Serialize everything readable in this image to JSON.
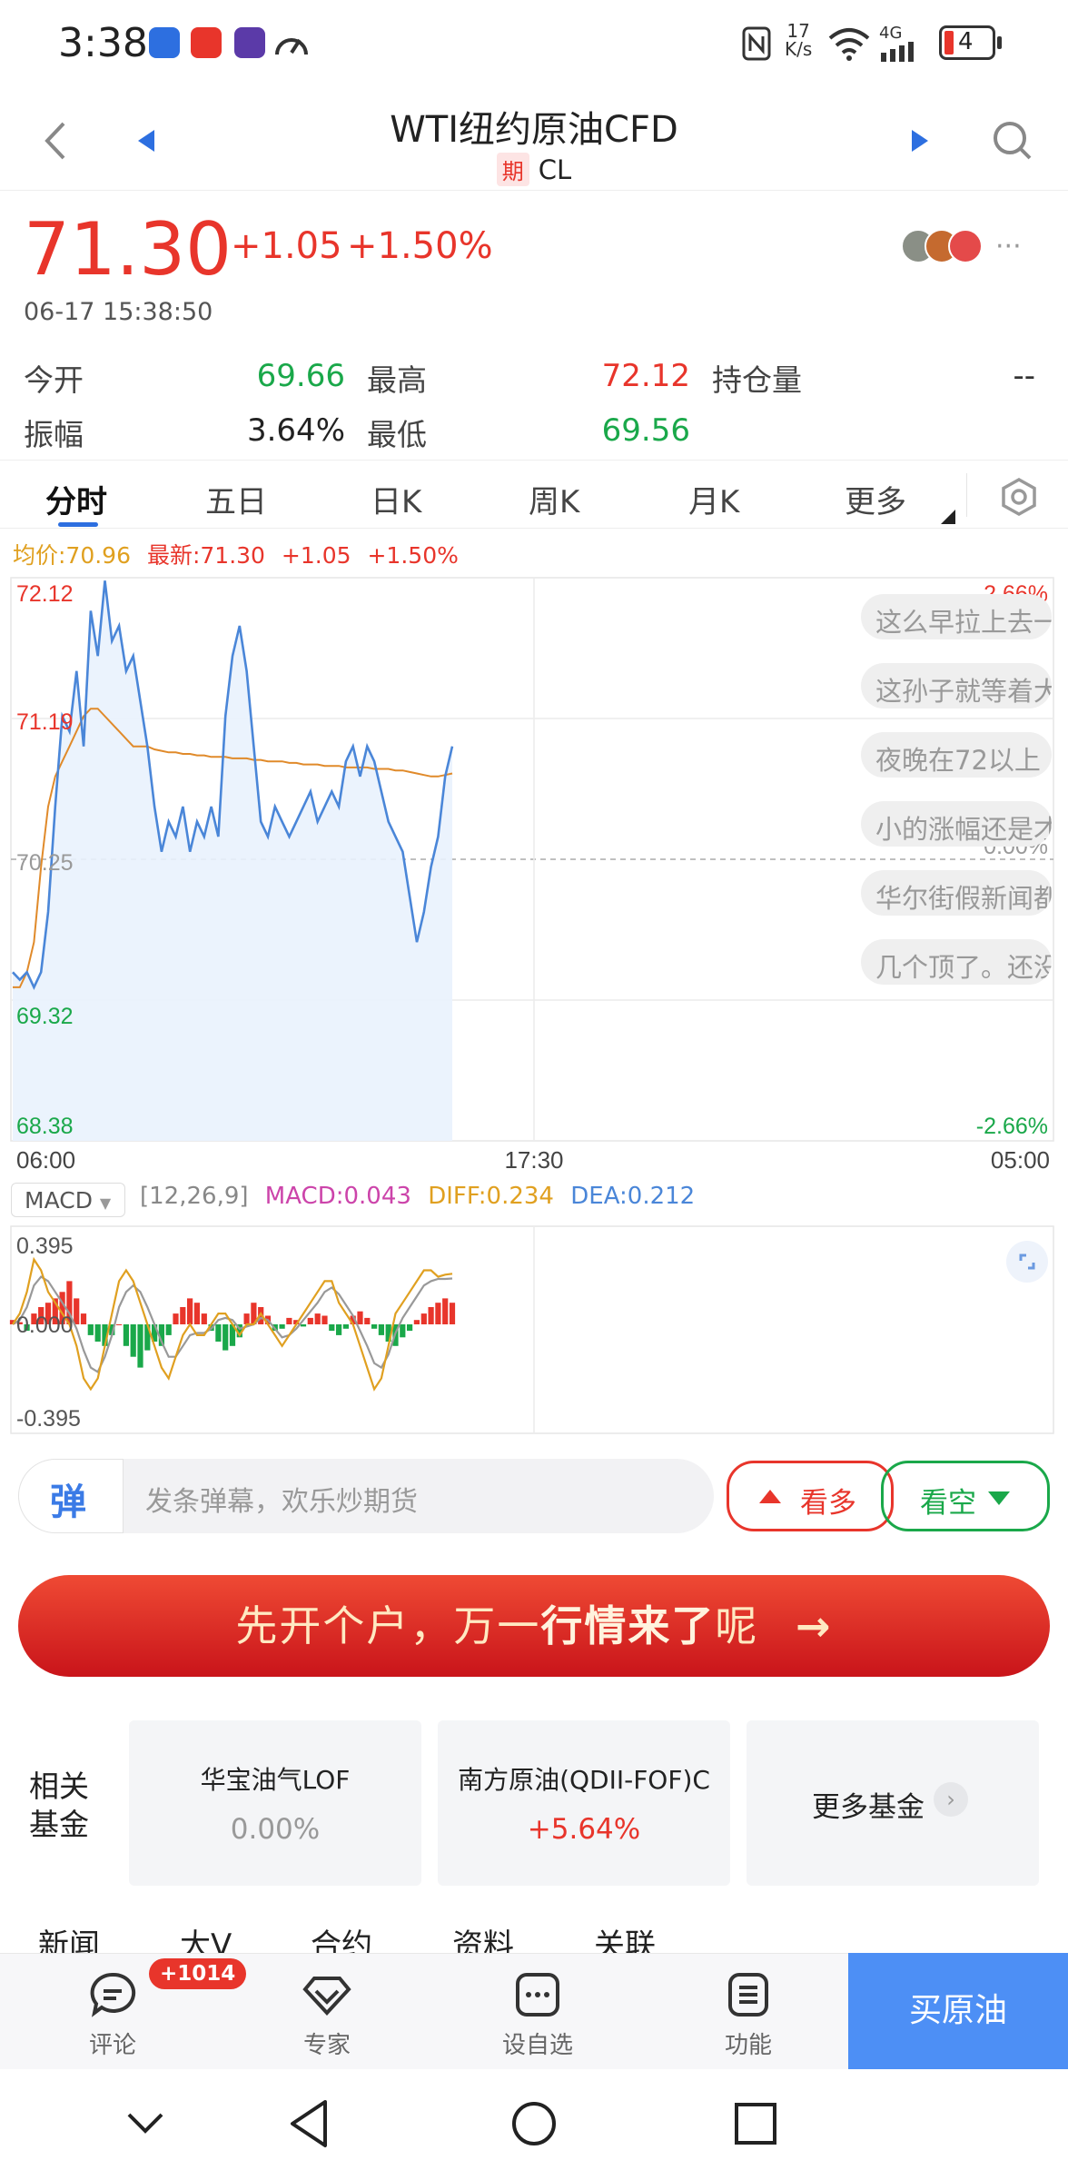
{
  "status_bar": {
    "time": "3:38",
    "net_speed_value": "17",
    "net_speed_unit": "K/s",
    "network": "4G",
    "battery": "4"
  },
  "nav": {
    "title": "WTI纽约原油CFD",
    "tag": "期",
    "code": "CL"
  },
  "quote": {
    "price": "71.30",
    "change": "+1.05",
    "change_pct": "+1.50%",
    "time": "06-17 15:38:50",
    "more": "···",
    "fields": [
      {
        "label": "今开",
        "value": "69.66",
        "color": "green"
      },
      {
        "label": "最高",
        "value": "72.12",
        "color": "red"
      },
      {
        "label": "持仓量",
        "value": "--",
        "color": "dark"
      },
      {
        "label": "振幅",
        "value": "3.64%",
        "color": "dark"
      },
      {
        "label": "最低",
        "value": "69.56",
        "color": "green"
      }
    ]
  },
  "tabs": [
    "分时",
    "五日",
    "日K",
    "周K",
    "月K",
    "更多"
  ],
  "chart_legend": {
    "avg": "均价:70.96",
    "latest": "最新:71.30",
    "change": "+1.05",
    "change_pct": "+1.50%"
  },
  "chart_data": {
    "type": "line",
    "title": "",
    "y_ticks_left": [
      "72.12",
      "71.19",
      "70.25",
      "69.32",
      "68.38"
    ],
    "y_ticks_right": [
      "2.66%",
      "0.00%",
      "-2.66%"
    ],
    "x_ticks": [
      "06:00",
      "17:30",
      "05:00"
    ],
    "ylim": [
      68.38,
      72.12
    ],
    "series": [
      {
        "name": "最新",
        "color": "#4a86d8",
        "values": [
          69.5,
          69.45,
          69.5,
          69.4,
          69.5,
          69.9,
          70.6,
          71.2,
          71.1,
          71.5,
          71.0,
          71.9,
          71.6,
          72.1,
          71.7,
          71.8,
          71.5,
          71.6,
          71.3,
          71.0,
          70.6,
          70.3,
          70.5,
          70.4,
          70.6,
          70.3,
          70.5,
          70.4,
          70.6,
          70.4,
          71.2,
          71.6,
          71.8,
          71.5,
          71.0,
          70.5,
          70.4,
          70.6,
          70.5,
          70.4,
          70.5,
          70.6,
          70.7,
          70.5,
          70.6,
          70.7,
          70.6,
          70.9,
          71.0,
          70.8,
          71.0,
          70.9,
          70.7,
          70.5,
          70.4,
          70.3,
          70.0,
          69.7,
          69.9,
          70.2,
          70.4,
          70.8,
          71.0
        ]
      },
      {
        "name": "均价",
        "color": "#e08a2a",
        "values": [
          69.4,
          69.4,
          69.5,
          69.7,
          70.2,
          70.6,
          70.8,
          70.9,
          71.0,
          71.1,
          71.2,
          71.25,
          71.25,
          71.2,
          71.15,
          71.1,
          71.05,
          71.0,
          71.0,
          71.0,
          70.98,
          70.97,
          70.96,
          70.96,
          70.95,
          70.95,
          70.94,
          70.94,
          70.93,
          70.93,
          70.93,
          70.92,
          70.92,
          70.92,
          70.91,
          70.91,
          70.9,
          70.9,
          70.9,
          70.89,
          70.89,
          70.88,
          70.88,
          70.88,
          70.87,
          70.87,
          70.87,
          70.86,
          70.86,
          70.86,
          70.86,
          70.85,
          70.85,
          70.85,
          70.84,
          70.84,
          70.83,
          70.82,
          70.81,
          70.8,
          70.8,
          70.81,
          70.82
        ]
      }
    ],
    "macd": {
      "selector": "MACD",
      "params": "[12,26,9]",
      "macd": "MACD:0.043",
      "diff": "DIFF:0.234",
      "dea": "DEA:0.212",
      "y_ticks": [
        "0.395",
        "0.000",
        "-0.395"
      ],
      "ylim": [
        -0.395,
        0.395
      ],
      "hist": [
        0.02,
        0.01,
        -0.03,
        0.05,
        0.08,
        0.1,
        0.12,
        0.15,
        0.2,
        0.12,
        0.05,
        -0.05,
        -0.08,
        -0.1,
        -0.05,
        0.0,
        -0.1,
        -0.15,
        -0.2,
        -0.12,
        -0.08,
        -0.1,
        -0.05,
        0.05,
        0.08,
        0.12,
        0.1,
        0.05,
        -0.03,
        -0.08,
        -0.12,
        -0.1,
        -0.06,
        0.05,
        0.1,
        0.08,
        0.04,
        -0.03,
        -0.02,
        0.03,
        0.02,
        -0.01,
        0.03,
        0.05,
        0.04,
        -0.03,
        -0.05,
        -0.02,
        0.04,
        0.06,
        0.03,
        -0.02,
        -0.05,
        -0.08,
        -0.1,
        -0.06,
        -0.03,
        0.02,
        0.05,
        0.08,
        0.1,
        0.12,
        0.1
      ],
      "diff_values": [
        0.0,
        0.05,
        0.15,
        0.3,
        0.25,
        0.15,
        0.1,
        0.05,
        0.0,
        -0.1,
        -0.25,
        -0.3,
        -0.25,
        -0.1,
        0.05,
        0.2,
        0.25,
        0.2,
        0.1,
        0.0,
        -0.1,
        -0.2,
        -0.25,
        -0.15,
        -0.05,
        0.0,
        -0.05,
        -0.05,
        0.0,
        0.05,
        0.05,
        0.0,
        -0.05,
        0.0,
        0.0,
        0.05,
        0.0,
        -0.05,
        -0.1,
        -0.05,
        0.0,
        0.05,
        0.1,
        0.15,
        0.2,
        0.2,
        0.1,
        0.05,
        0.0,
        -0.1,
        -0.2,
        -0.3,
        -0.25,
        -0.1,
        0.05,
        0.1,
        0.15,
        0.2,
        0.25,
        0.25,
        0.22,
        0.23,
        0.234
      ],
      "dea_values": [
        0.0,
        0.02,
        0.08,
        0.18,
        0.22,
        0.2,
        0.15,
        0.1,
        0.05,
        -0.02,
        -0.12,
        -0.2,
        -0.22,
        -0.15,
        -0.05,
        0.08,
        0.15,
        0.18,
        0.15,
        0.08,
        0.0,
        -0.08,
        -0.15,
        -0.15,
        -0.1,
        -0.05,
        -0.04,
        -0.04,
        -0.02,
        0.02,
        0.03,
        0.02,
        -0.02,
        -0.01,
        0.0,
        0.03,
        0.02,
        -0.02,
        -0.06,
        -0.05,
        -0.02,
        0.02,
        0.06,
        0.1,
        0.15,
        0.17,
        0.14,
        0.09,
        0.04,
        -0.03,
        -0.1,
        -0.18,
        -0.2,
        -0.14,
        -0.04,
        0.03,
        0.08,
        0.13,
        0.18,
        0.2,
        0.21,
        0.21,
        0.212
      ]
    }
  },
  "danmu": [
    "这么早拉上去一",
    "这孙子就等着大",
    "夜晚在72以上",
    "小的涨幅还是才",
    "华尔街假新闻都",
    "几个顶了。还没"
  ],
  "comment": {
    "badge": "弹",
    "placeholder": "发条弹幕，欢乐炒期货",
    "bull": "看多",
    "bear": "看空"
  },
  "banner": {
    "text_a": "先开个户，万一",
    "text_b": "行情来了",
    "text_c": "呢",
    "arrow": "→"
  },
  "funds": {
    "label_line1": "相关",
    "label_line2": "基金",
    "cards": [
      {
        "name": "华宝油气LOF",
        "pct": "0.00%",
        "color": "gray"
      },
      {
        "name": "南方原油(QDII-FOF)C",
        "pct": "+5.64%",
        "color": "red"
      }
    ],
    "more": "更多基金"
  },
  "news_tabs": [
    "新闻",
    "大V",
    "合约",
    "资料",
    "关联"
  ],
  "bottom_nav": {
    "badge": "+1014",
    "items": [
      "评论",
      "专家",
      "设自选",
      "功能"
    ],
    "buy": "买原油"
  },
  "colors": {
    "up": "#e8352b",
    "down": "#1aa84a",
    "accent": "#2d6fe0",
    "buy_button": "#4d8ff5"
  }
}
